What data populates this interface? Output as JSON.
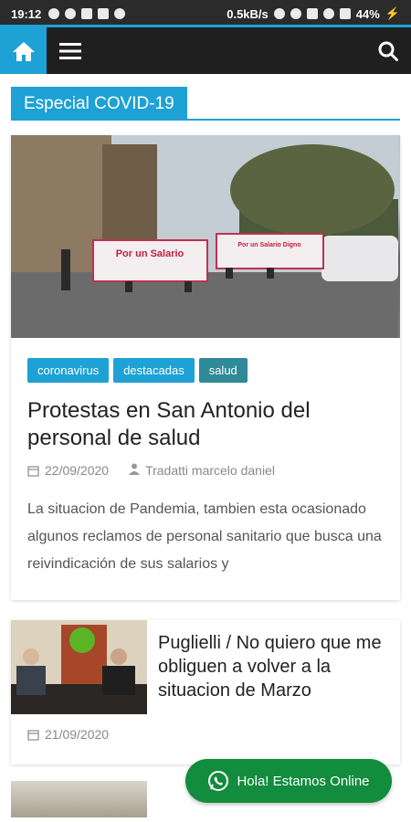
{
  "status_bar": {
    "time": "19:12",
    "network_speed": "0.5kB/s",
    "battery": "44%"
  },
  "navbar": {
    "home_icon": "home-icon",
    "menu_icon": "hamburger-icon",
    "search_icon": "search-icon"
  },
  "section": {
    "title": "Especial COVID-19"
  },
  "featured": {
    "tags": [
      "coronavirus",
      "destacadas",
      "salud"
    ],
    "title": "Protestas en San Antonio del personal de salud",
    "date": "22/09/2020",
    "author": "Tradatti marcelo daniel",
    "excerpt": "La situacion de Pandemia, tambien esta ocasionado algunos reclamos de personal sanitario que busca una reivindicación de sus salarios y",
    "banner_left": "Por un Salario",
    "banner_right": "Por un Salario Digno"
  },
  "list": [
    {
      "title": "Puglielli / No quiero que me obliguen a volver a la situacion de Marzo",
      "date": "21/09/2020"
    }
  ],
  "whatsapp": {
    "label": "Hola! Estamos Online",
    "icon": "whatsapp-icon"
  },
  "colors": {
    "accent": "#1ea1d4",
    "tag_teal": "#2e8a96",
    "whatsapp_green": "#128c3d",
    "navbar": "#1f1f1f"
  }
}
